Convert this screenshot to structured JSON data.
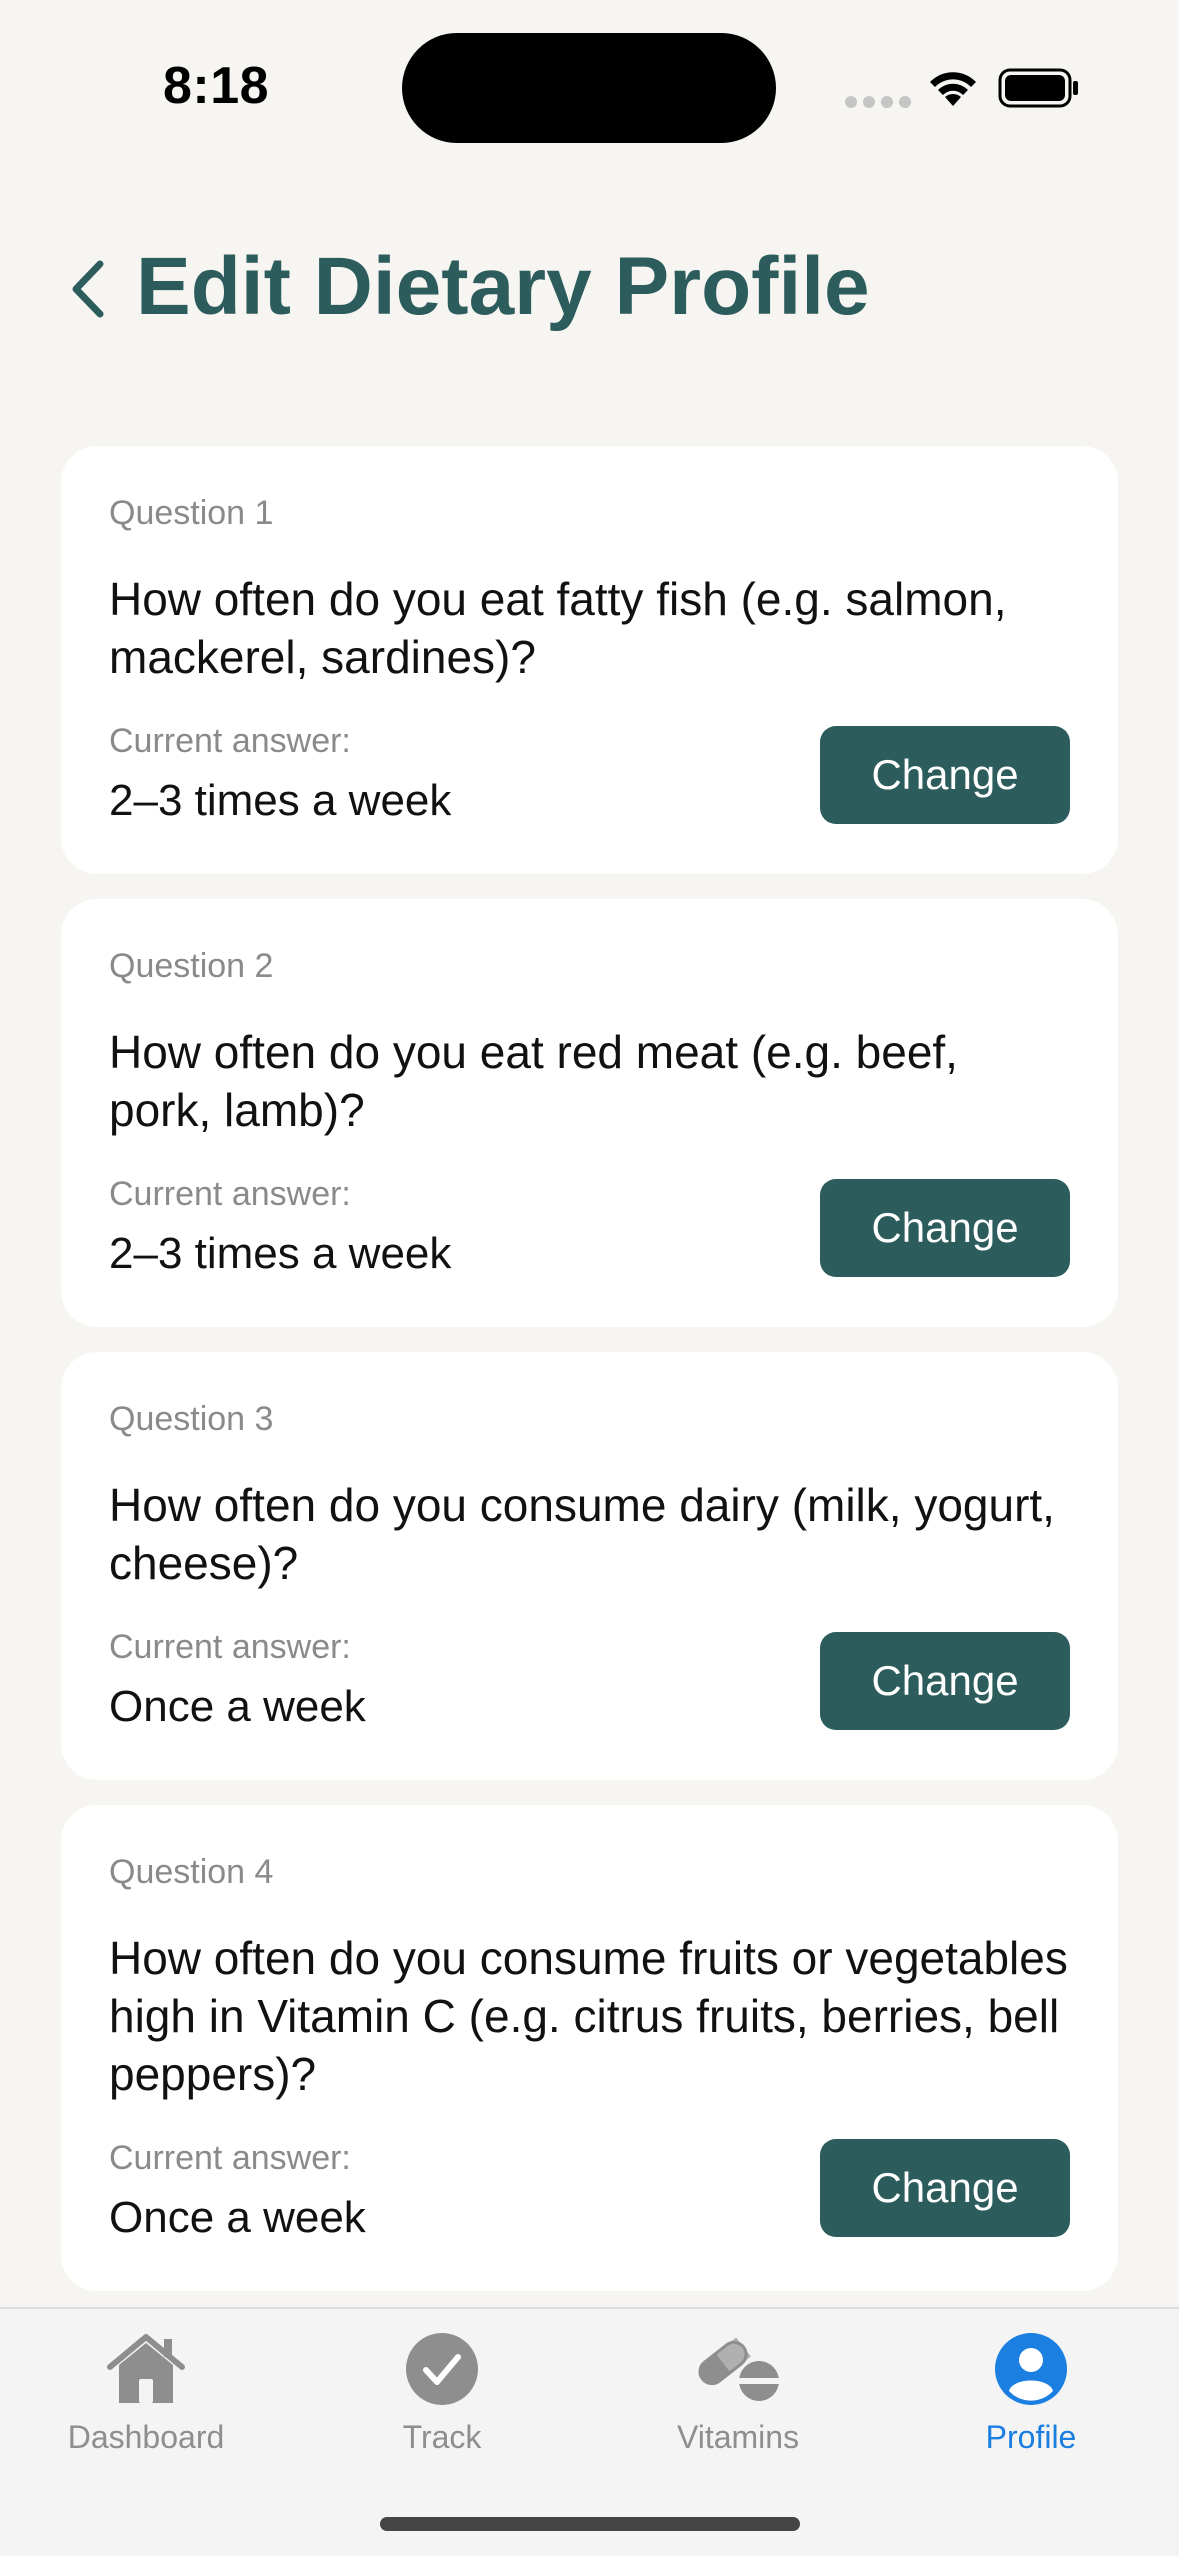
{
  "status_bar": {
    "time": "8:18"
  },
  "header": {
    "title": "Edit Dietary Profile"
  },
  "answer_label": "Current answer:",
  "change_label": "Change",
  "questions": [
    {
      "number": "Question 1",
      "text": "How often do you eat fatty fish (e.g. salmon, mackerel, sardines)?",
      "answer": "2–3 times a week"
    },
    {
      "number": "Question 2",
      "text": "How often do you eat red meat (e.g. beef, pork, lamb)?",
      "answer": "2–3 times a week"
    },
    {
      "number": "Question 3",
      "text": "How often do you consume dairy (milk, yogurt, cheese)?",
      "answer": "Once a week"
    },
    {
      "number": "Question 4",
      "text": "How often do you consume fruits or vegetables high in Vitamin C (e.g. citrus fruits, berries, bell peppers)?",
      "answer": "Once a week"
    }
  ],
  "tab_bar": {
    "tabs": [
      {
        "label": "Dashboard",
        "icon": "house-icon",
        "active": false
      },
      {
        "label": "Track",
        "icon": "checkmark-circle-icon",
        "active": false
      },
      {
        "label": "Vitamins",
        "icon": "pills-icon",
        "active": false
      },
      {
        "label": "Profile",
        "icon": "person-circle-icon",
        "active": true
      }
    ]
  },
  "colors": {
    "accent": "#2d5c5c",
    "active_tab": "#1a7fe0",
    "background": "#f6f5f1"
  }
}
